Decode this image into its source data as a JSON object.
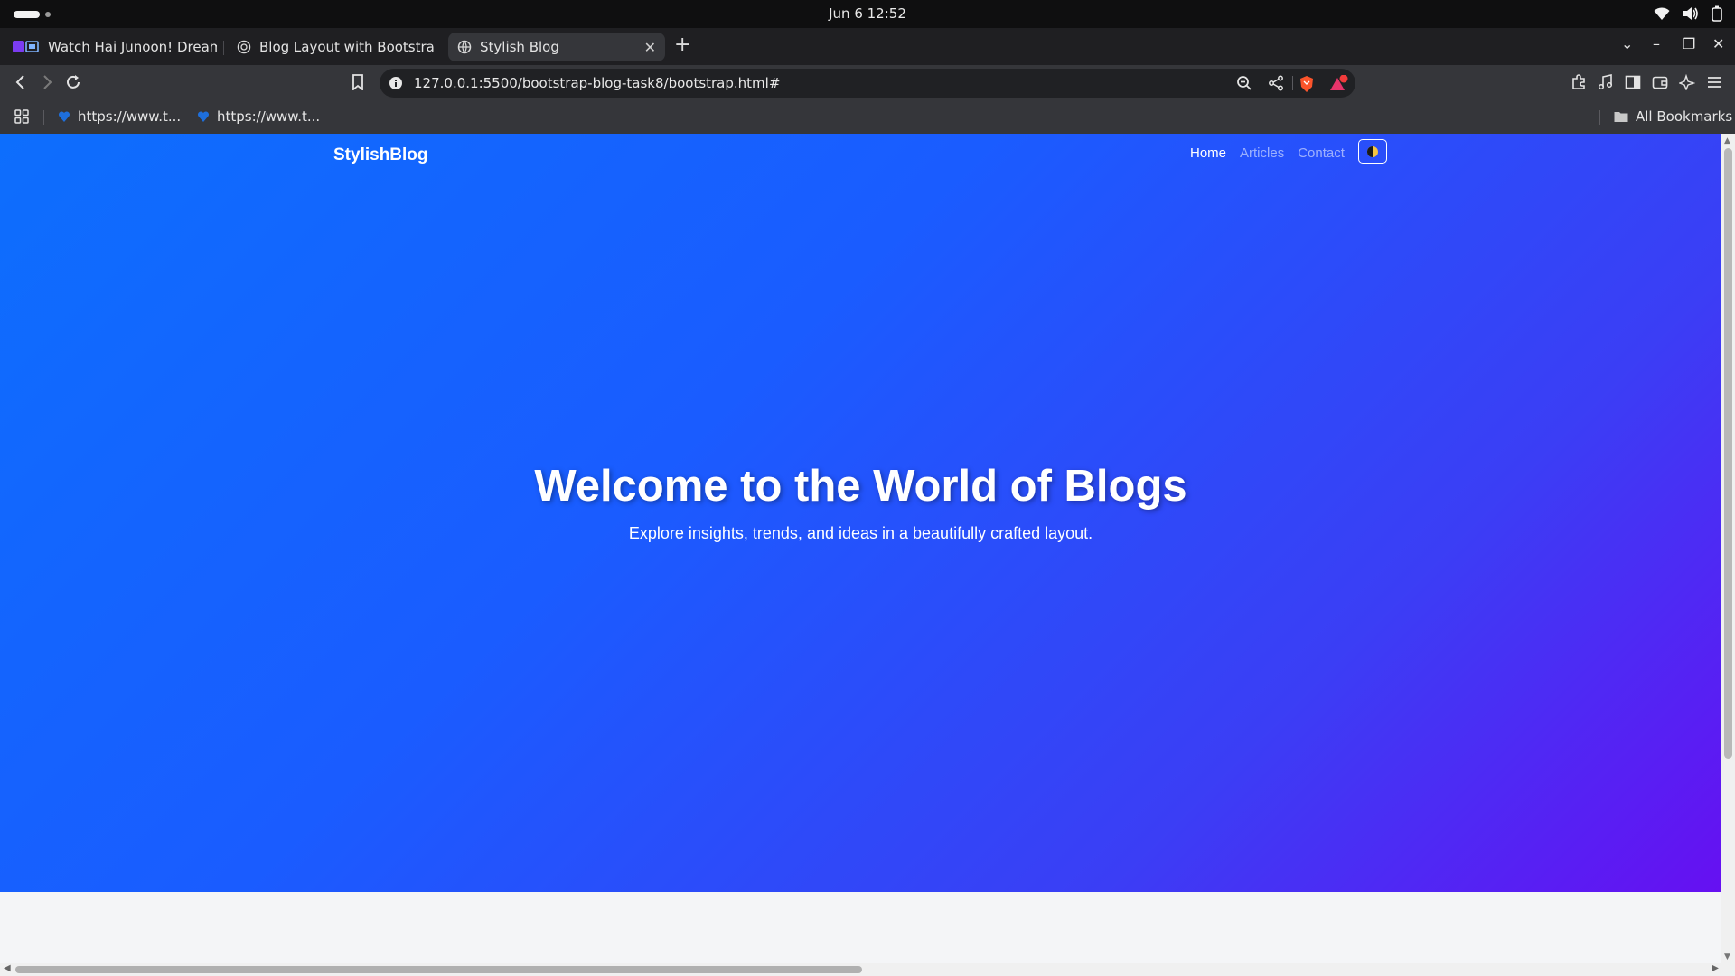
{
  "os": {
    "datetime": "Jun 6  12:52",
    "icons": [
      "wifi-icon",
      "volume-icon",
      "battery-icon"
    ]
  },
  "tabs": [
    {
      "title": "Watch Hai Junoon! Dream",
      "favicon": "streaming-app-icon",
      "active": false
    },
    {
      "title": "Blog Layout with Bootstrap",
      "favicon": "globe-icon",
      "active": false
    },
    {
      "title": "Stylish Blog",
      "favicon": "globe-icon",
      "active": true
    }
  ],
  "toolbar": {
    "url": "127.0.0.1:5500/bootstrap-blog-task8/bootstrap.html#",
    "notification_count": "1"
  },
  "bookmarks": {
    "items": [
      {
        "label": "https://www.t...",
        "favicon": "heart-bookmark-icon"
      },
      {
        "label": "https://www.t...",
        "favicon": "heart-bookmark-icon"
      }
    ],
    "all_bookmarks": "All Bookmarks"
  },
  "page": {
    "brand": "StylishBlog",
    "nav": [
      {
        "label": "Home",
        "active": true
      },
      {
        "label": "Articles",
        "active": false
      },
      {
        "label": "Contact",
        "active": false
      }
    ],
    "hero": {
      "title": "Welcome to the World of Blogs",
      "subtitle": "Explore insights, trends, and ideas in a beautifully crafted layout."
    },
    "colors": {
      "gradient_start": "#0d6efd",
      "gradient_end": "#6610f2",
      "below_hero": "#f4f5f7"
    }
  }
}
